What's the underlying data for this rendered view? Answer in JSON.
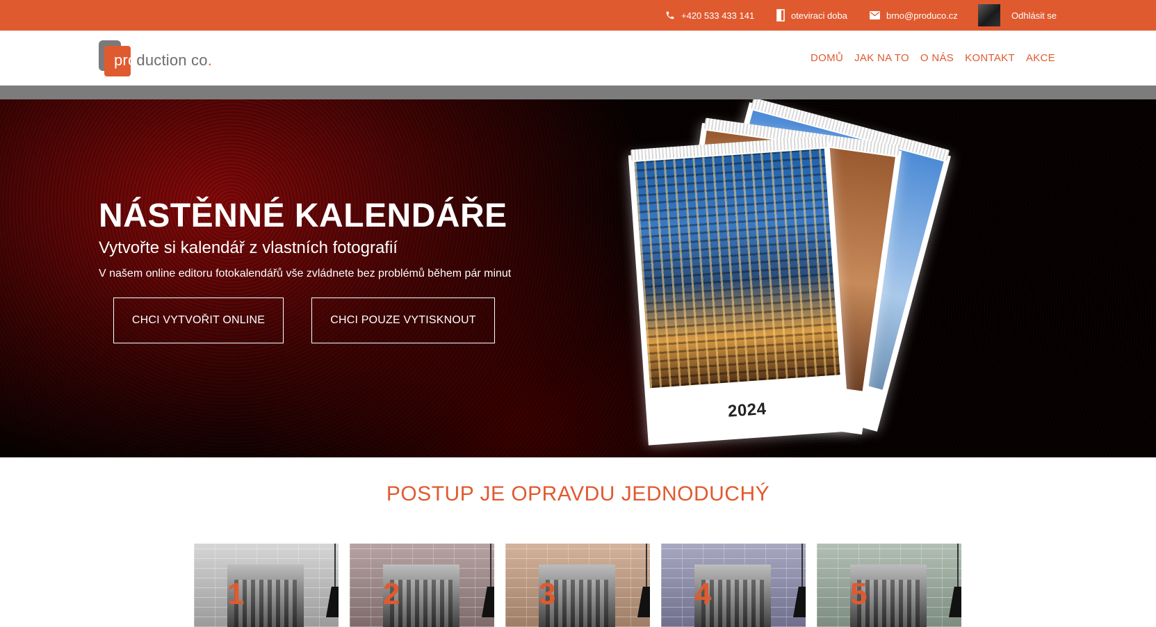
{
  "topbar": {
    "phone": "+420 533 433 141",
    "hours": "oteviraci doba",
    "email": "brno@produco.cz",
    "logout": "Odhlásit se"
  },
  "logo": {
    "pro": "pro",
    "rest": "duction co",
    "dot": "."
  },
  "nav": {
    "home": "DOMŮ",
    "howto": "JAK NA TO",
    "about": "O NÁS",
    "contact": "KONTAKT",
    "sale": "AKCE"
  },
  "hero": {
    "title": "NÁSTĚNNÉ KALENDÁŘE",
    "subtitle": "Vytvořte si kalendář z vlastních fotografií",
    "description": "V našem online editoru fotokalendářů vše zvládnete bez problémů během pár minut",
    "btn_online": "CHCI VYTVOŘIT ONLINE",
    "btn_print": "CHCI POUZE VYTISKNOUT",
    "calendar_year": "2024"
  },
  "steps": {
    "title": "POSTUP JE OPRAVDU JEDNODUCHÝ",
    "items": [
      "1",
      "2",
      "3",
      "4",
      "5"
    ]
  },
  "colors": {
    "accent": "#e05a2f",
    "grey_bar": "#7c7c7c"
  }
}
